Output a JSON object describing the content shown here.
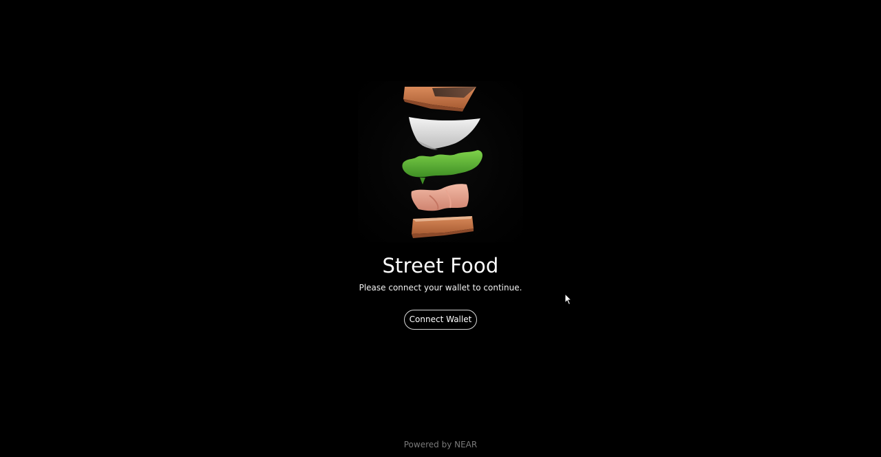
{
  "app": {
    "title": "Street Food",
    "subtitle": "Please connect your wallet to continue.",
    "connect_button_label": "Connect Wallet",
    "footer": "Powered by NEAR"
  },
  "hero_image": {
    "description_icon": "deconstructed-sandwich-image"
  },
  "colors": {
    "background": "#000000",
    "text": "#ffffff",
    "footer_text": "#7a7a7a",
    "button_border": "#d9d9d9"
  }
}
